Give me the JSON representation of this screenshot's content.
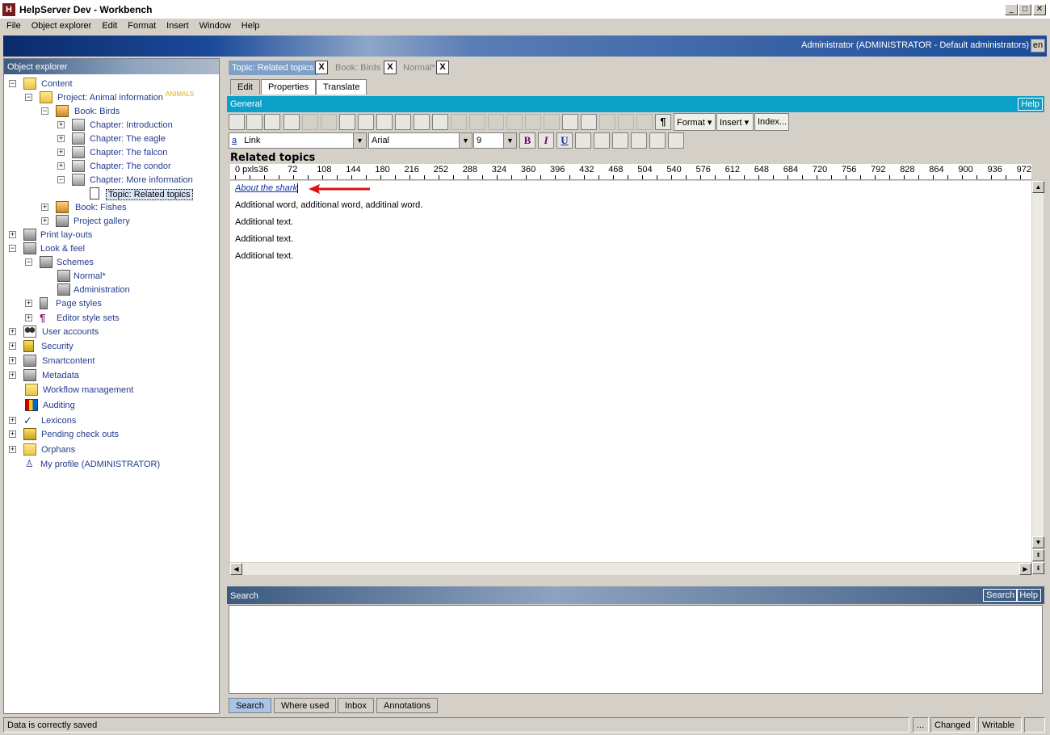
{
  "window": {
    "title": "HelpServer Dev - Workbench",
    "app_icon": "H",
    "min": "_",
    "max": "□",
    "close": "✕"
  },
  "menu": [
    "File",
    "Object explorer",
    "Edit",
    "Format",
    "Insert",
    "Window",
    "Help"
  ],
  "banner": {
    "user": "Administrator (ADMINISTRATOR - Default administrators)",
    "lang": "en"
  },
  "explorer": {
    "title": "Object explorer",
    "items": [
      {
        "label": "Content"
      },
      {
        "label": "Project: Animal information",
        "tag": "ANIMALS"
      },
      {
        "label": "Book: Birds"
      },
      {
        "label": "Chapter: Introduction"
      },
      {
        "label": "Chapter: The eagle"
      },
      {
        "label": "Chapter: The falcon"
      },
      {
        "label": "Chapter: The condor"
      },
      {
        "label": "Chapter: More information"
      },
      {
        "label": "Topic: Related topics"
      },
      {
        "label": "Book: Fishes"
      },
      {
        "label": "Project gallery"
      },
      {
        "label": "Print lay-outs"
      },
      {
        "label": "Look & feel"
      },
      {
        "label": "Schemes"
      },
      {
        "label": "Normal*"
      },
      {
        "label": "Administration"
      },
      {
        "label": "Page styles"
      },
      {
        "label": "Editor style sets"
      },
      {
        "label": "User accounts"
      },
      {
        "label": "Security"
      },
      {
        "label": "Smartcontent"
      },
      {
        "label": "Metadata"
      },
      {
        "label": "Workflow management"
      },
      {
        "label": "Auditing"
      },
      {
        "label": "Lexicons"
      },
      {
        "label": "Pending check outs"
      },
      {
        "label": "Orphans"
      },
      {
        "label": "My profile (ADMINISTRATOR)"
      }
    ]
  },
  "doc_tabs": [
    {
      "label": "Topic: Related topics",
      "close": "X"
    },
    {
      "label": "Book: Birds",
      "close": "X"
    },
    {
      "label": "Normal*",
      "close": "X"
    }
  ],
  "sub_tabs": [
    "Edit",
    "Properties",
    "Translate"
  ],
  "general": {
    "label": "General",
    "help": "Help"
  },
  "toolbar": {
    "format": "Format",
    "insert": "Insert",
    "index": "Index..."
  },
  "formatbar": {
    "style_icon": "a",
    "style": "Link",
    "font": "Arial",
    "size": "9",
    "bold": "B",
    "italic": "I",
    "underline": "U"
  },
  "editor": {
    "heading": "Related topics",
    "ruler": [
      "0 pxls",
      "36",
      "72",
      "108",
      "144",
      "180",
      "216",
      "252",
      "288",
      "324",
      "360",
      "396",
      "432",
      "468",
      "504",
      "540",
      "576",
      "612",
      "648",
      "684",
      "720",
      "756",
      "792",
      "828",
      "864",
      "900",
      "936",
      "972"
    ],
    "link": "About the shark",
    "lines": [
      "Additional word, additional word, additinal word.",
      "Additional text.",
      "Additional text.",
      "Additional text."
    ]
  },
  "search": {
    "label": "Search",
    "search_btn": "Search",
    "help_btn": "Help"
  },
  "bottom_tabs": [
    "Search",
    "Where used",
    "Inbox",
    "Annotations"
  ],
  "status": {
    "message": "Data is correctly saved",
    "dots": "...",
    "changed": "Changed",
    "writable": "Writable"
  }
}
